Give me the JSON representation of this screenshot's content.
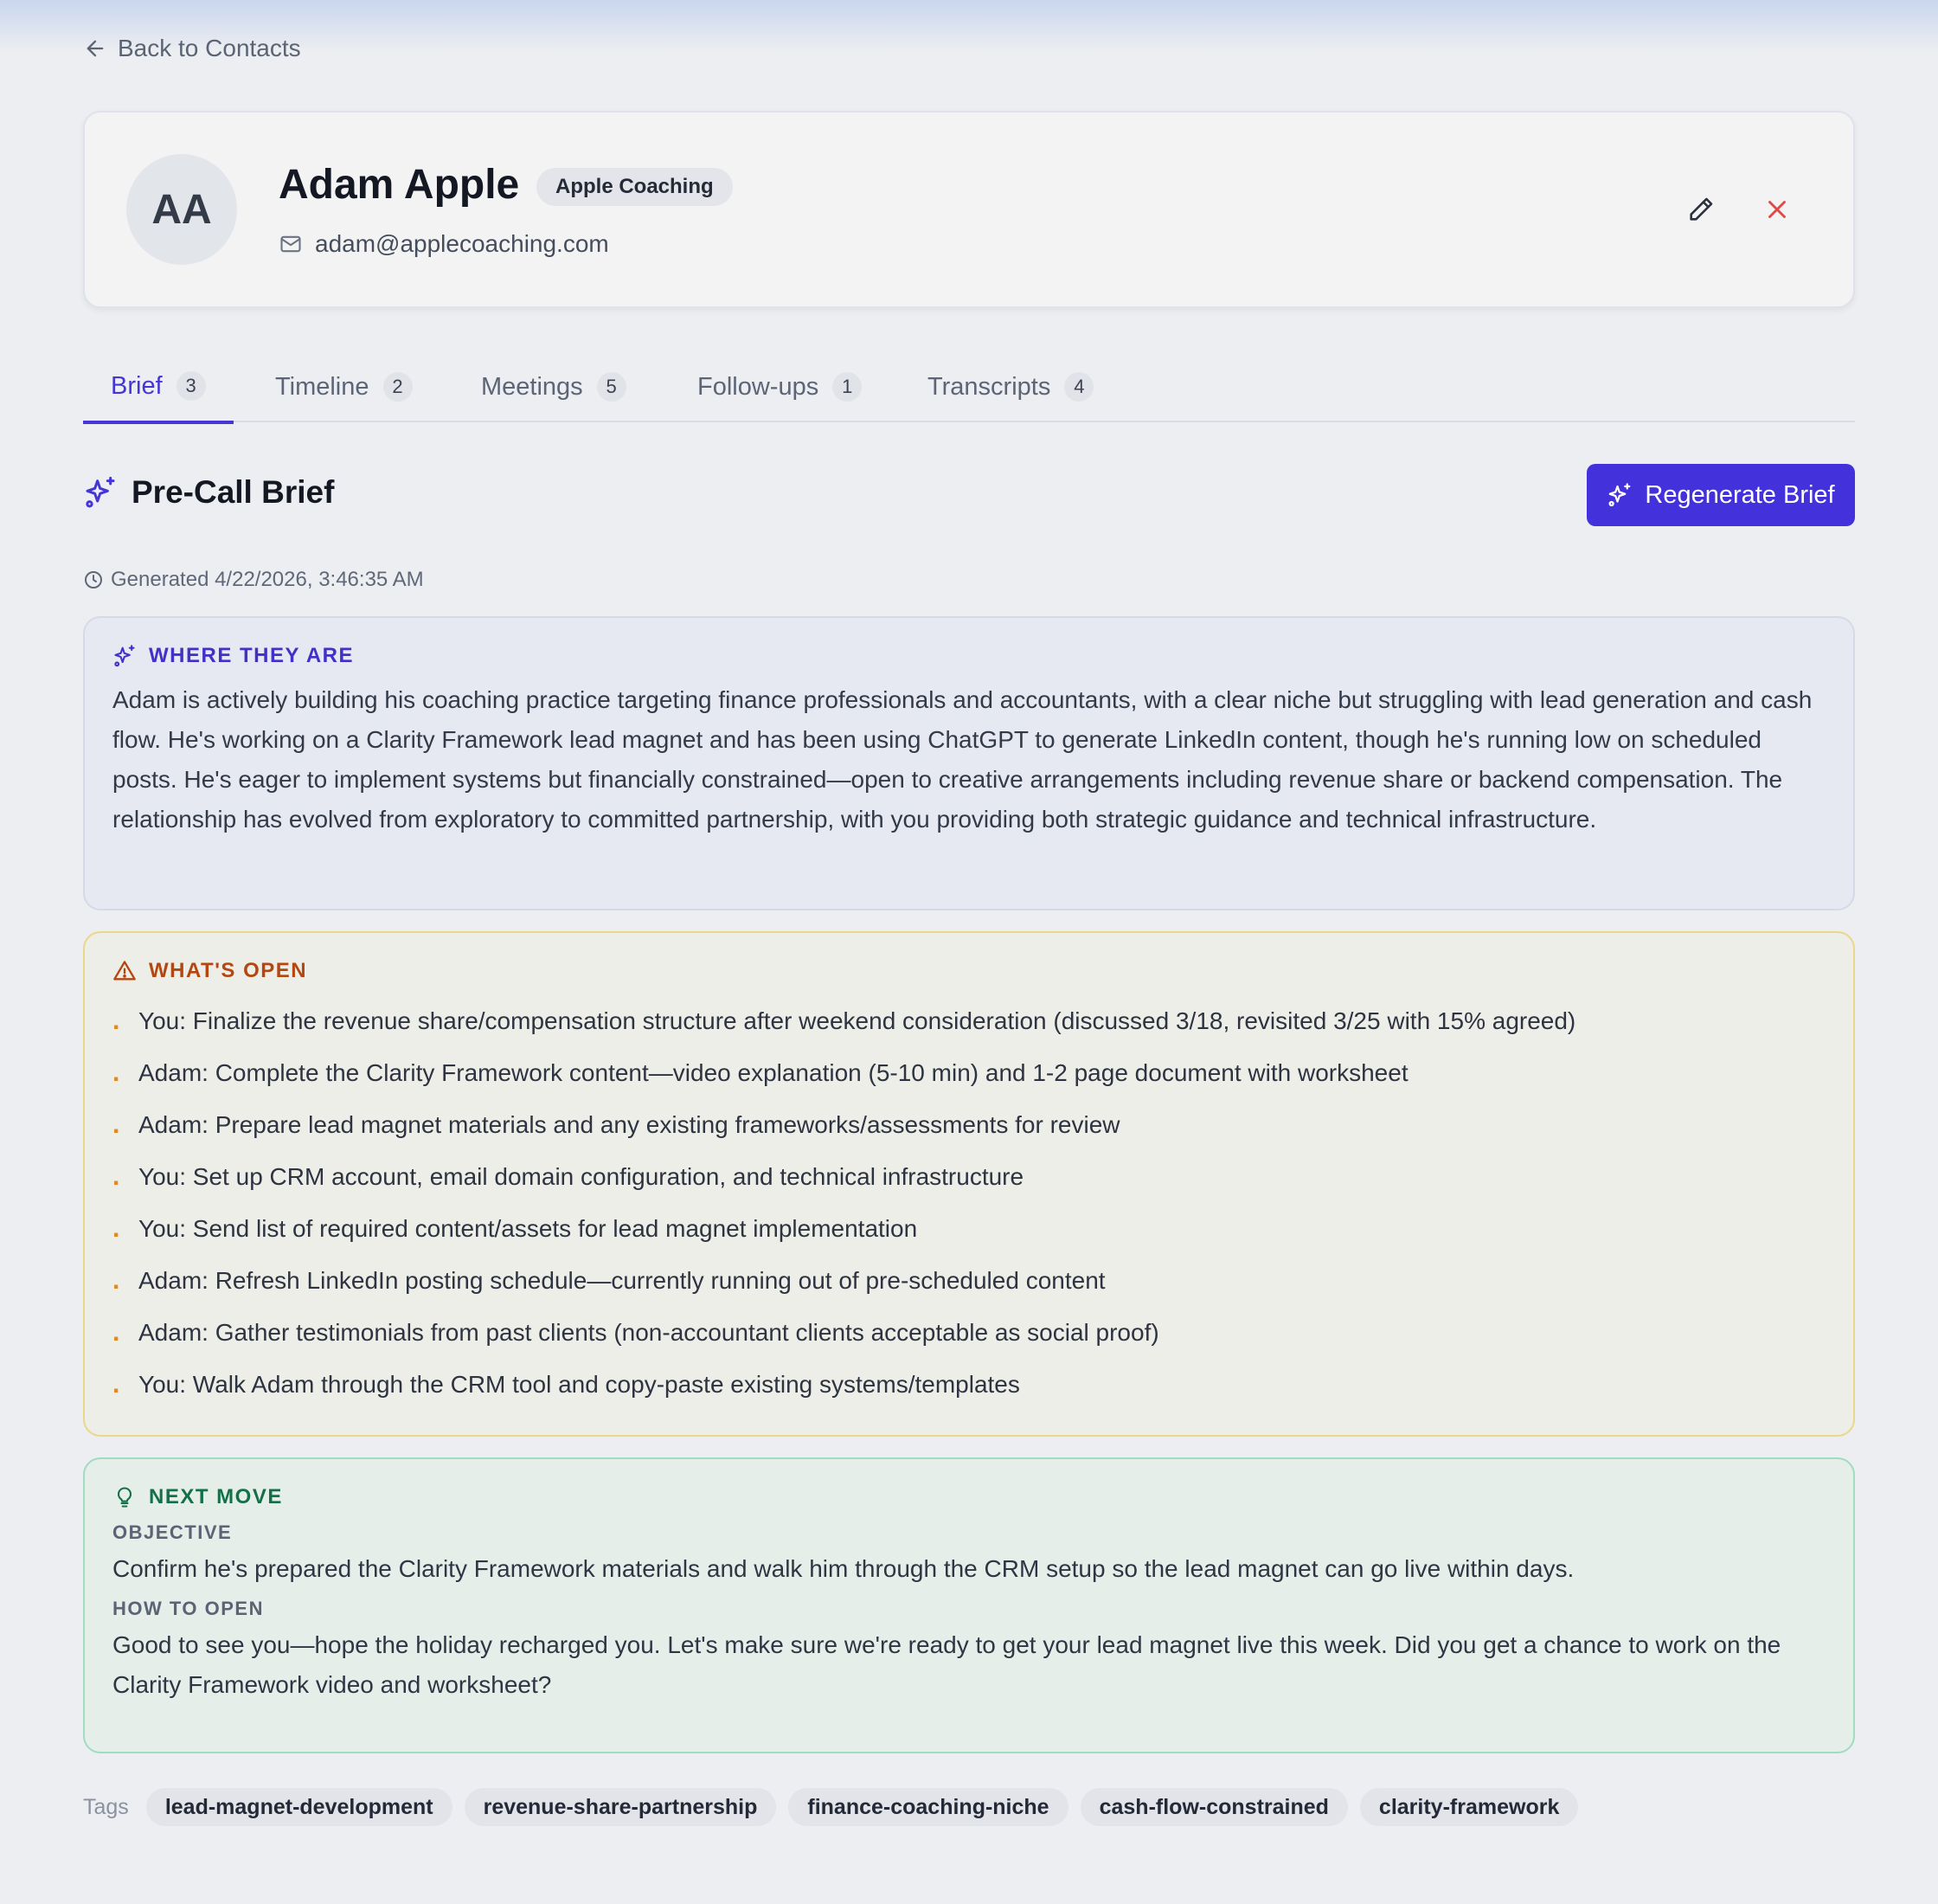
{
  "nav": {
    "back_label": "Back to Contacts"
  },
  "contact": {
    "initials": "AA",
    "name": "Adam Apple",
    "company": "Apple Coaching",
    "email": "adam@applecoaching.com"
  },
  "tabs": [
    {
      "label": "Brief",
      "count": "3",
      "active": true
    },
    {
      "label": "Timeline",
      "count": "2",
      "active": false
    },
    {
      "label": "Meetings",
      "count": "5",
      "active": false
    },
    {
      "label": "Follow-ups",
      "count": "1",
      "active": false
    },
    {
      "label": "Transcripts",
      "count": "4",
      "active": false
    }
  ],
  "brief": {
    "title": "Pre-Call Brief",
    "regenerate_label": "Regenerate Brief",
    "generated": "Generated 4/22/2026, 3:46:35 AM",
    "where": {
      "heading": "WHERE THEY ARE",
      "text": "Adam is actively building his coaching practice targeting finance professionals and accountants, with a clear niche but struggling with lead generation and cash flow. He's working on a Clarity Framework lead magnet and has been using ChatGPT to generate LinkedIn content, though he's running low on scheduled posts. He's eager to implement systems but financially constrained—open to creative arrangements including revenue share or backend compensation. The relationship has evolved from exploratory to committed partnership, with you providing both strategic guidance and technical infrastructure."
    },
    "open": {
      "heading": "WHAT'S OPEN",
      "items": [
        "You: Finalize the revenue share/compensation structure after weekend consideration (discussed 3/18, revisited 3/25 with 15% agreed)",
        "Adam: Complete the Clarity Framework content—video explanation (5-10 min) and 1-2 page document with worksheet",
        "Adam: Prepare lead magnet materials and any existing frameworks/assessments for review",
        "You: Set up CRM account, email domain configuration, and technical infrastructure",
        "You: Send list of required content/assets for lead magnet implementation",
        "Adam: Refresh LinkedIn posting schedule—currently running out of pre-scheduled content",
        "Adam: Gather testimonials from past clients (non-accountant clients acceptable as social proof)",
        "You: Walk Adam through the CRM tool and copy-paste existing systems/templates"
      ]
    },
    "next": {
      "heading": "NEXT MOVE",
      "objective_label": "OBJECTIVE",
      "objective": "Confirm he's prepared the Clarity Framework materials and walk him through the CRM setup so the lead magnet can go live within days.",
      "how_label": "HOW TO OPEN",
      "how": "Good to see you—hope the holiday recharged you. Let's make sure we're ready to get your lead magnet live this week. Did you get a chance to work on the Clarity Framework video and worksheet?"
    }
  },
  "tags": {
    "label": "Tags",
    "items": [
      "lead-magnet-development",
      "revenue-share-partnership",
      "finance-coaching-niche",
      "cash-flow-constrained",
      "clarity-framework"
    ]
  },
  "colors": {
    "accent": "#4331dc",
    "where_heading": "#4230c9",
    "open_heading": "#b4470f",
    "open_bullet": "#e08a1c",
    "next_heading": "#137048",
    "delete": "#e04848"
  }
}
